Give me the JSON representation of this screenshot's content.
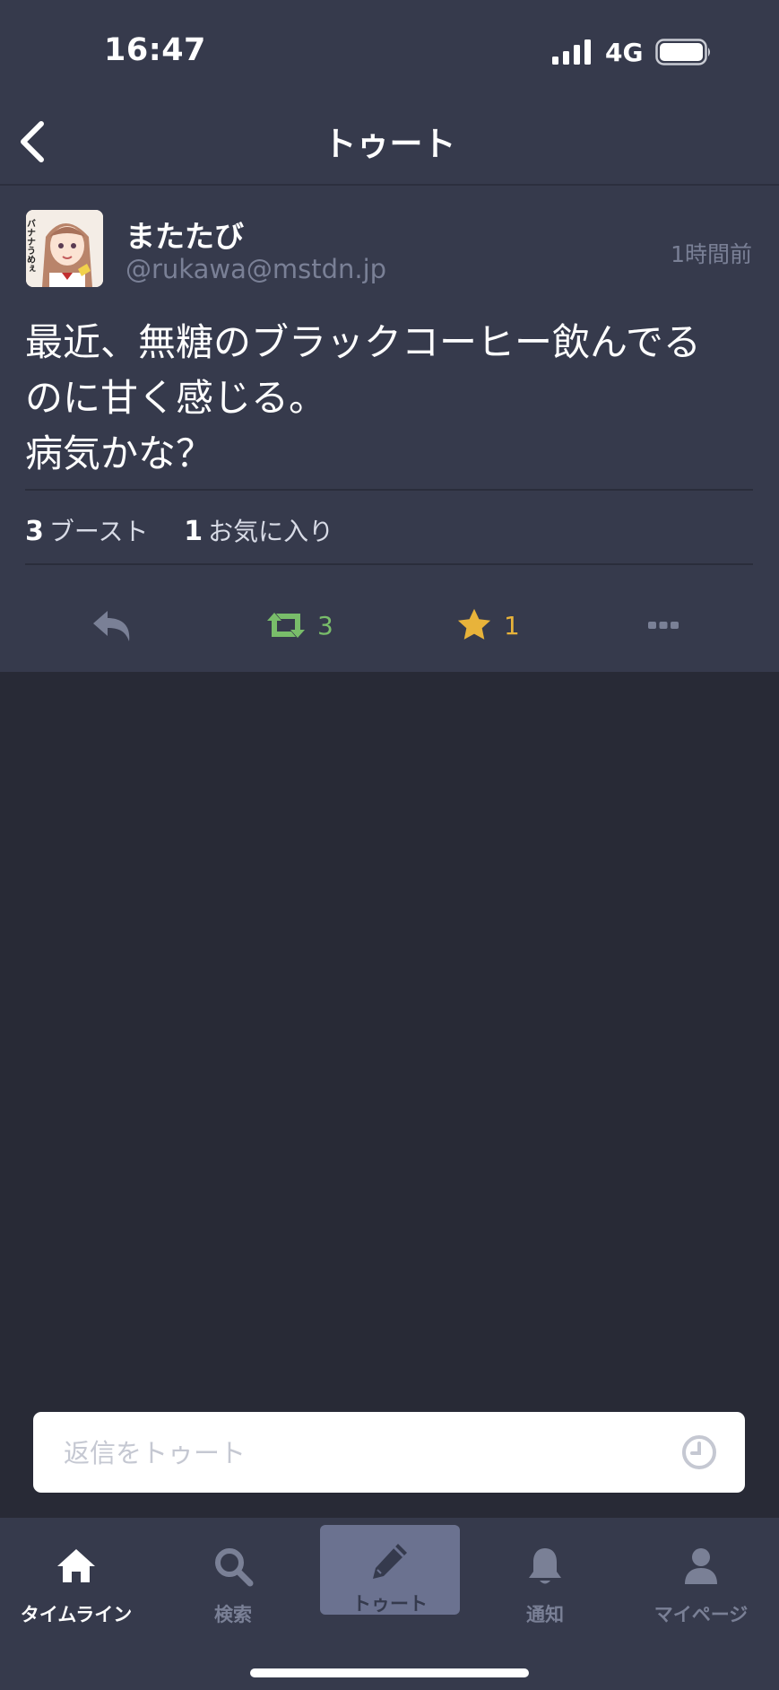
{
  "status_bar": {
    "time": "16:47",
    "network": "4G"
  },
  "nav": {
    "title": "トゥート"
  },
  "toot": {
    "display_name": "またたび",
    "acct": "@rukawa@mstdn.jp",
    "time_ago": "1時間前",
    "avatar_label": "バナナうめぇ",
    "content_lines": [
      "最近、無糖のブラックコーヒー飲んでる",
      "のに甘く感じる。",
      "病気かな？"
    ],
    "boost_count": "3",
    "boost_label": "ブースト",
    "fav_count": "1",
    "fav_label": "お気に入り",
    "action_boost_count": "3",
    "action_fav_count": "1"
  },
  "reply": {
    "placeholder": "返信をトゥート"
  },
  "tabbar": {
    "tabs": [
      {
        "label": "タイムライン",
        "icon": "home-icon",
        "active": true
      },
      {
        "label": "検索",
        "icon": "search-icon"
      },
      {
        "label": "トゥート",
        "icon": "pencil-icon"
      },
      {
        "label": "通知",
        "icon": "bell-icon"
      },
      {
        "label": "マイページ",
        "icon": "user-icon"
      }
    ]
  },
  "colors": {
    "background": "#282a36",
    "panel": "#363a4c",
    "muted_text": "#7a8096",
    "boost_green": "#79bd6a",
    "fav_yellow": "#e8b33a",
    "compose_highlight": "#6b7290"
  }
}
